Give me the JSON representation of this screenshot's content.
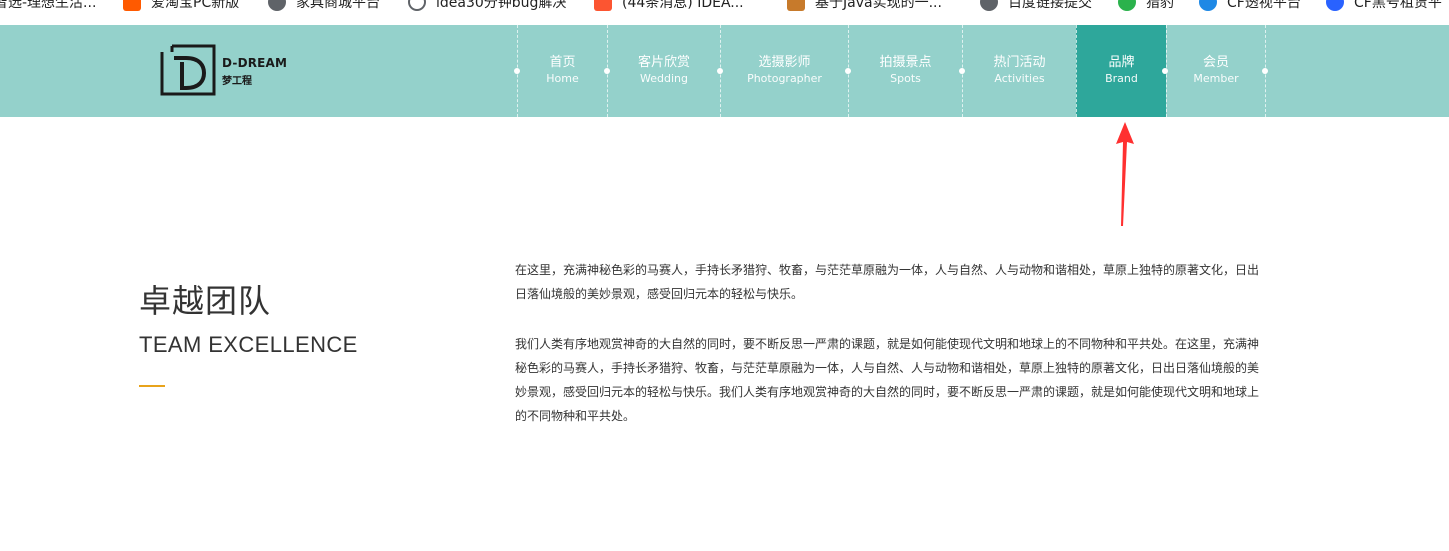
{
  "bookmarks": [
    {
      "label": "智选-理想生活...",
      "icon": "bookmark-icon",
      "color": "#b0b0b0"
    },
    {
      "label": "爱淘宝PC新版",
      "icon": "taobao-icon",
      "color": "#ff5a00"
    },
    {
      "label": "家具商城平台",
      "icon": "globe-icon",
      "color": "#5f6368"
    },
    {
      "label": "idea30分钟bug解决",
      "icon": "search-icon",
      "color": "#5f6368"
    },
    {
      "label": "(44条消息) IDEA...",
      "icon": "csdn-icon",
      "color": "#fc5531"
    },
    {
      "label": "基于Java实现的一...",
      "icon": "bookmark-icon",
      "color": "#c77a2b"
    },
    {
      "label": "百度链接提交",
      "icon": "globe-icon",
      "color": "#5f6368"
    },
    {
      "label": "猎豹",
      "icon": "leaf-icon",
      "color": "#2bb24c"
    },
    {
      "label": "CF透视平台",
      "icon": "cf-icon",
      "color": "#1e88e5"
    },
    {
      "label": "CF黑号租赁平",
      "icon": "paw-icon",
      "color": "#2962ff"
    }
  ],
  "header": {
    "logo": {
      "en": "D-DREAM",
      "cn": "梦工程"
    },
    "nav": [
      {
        "cn": "首页",
        "en": "Home",
        "active": false
      },
      {
        "cn": "客片欣赏",
        "en": "Wedding",
        "active": false
      },
      {
        "cn": "选摄影师",
        "en": "Photographer",
        "active": false
      },
      {
        "cn": "拍摄景点",
        "en": "Spots",
        "active": false
      },
      {
        "cn": "热门活动",
        "en": "Activities",
        "active": false
      },
      {
        "cn": "品牌",
        "en": "Brand",
        "active": true
      },
      {
        "cn": "会员",
        "en": "Member",
        "active": false
      }
    ]
  },
  "colors": {
    "header_bg": "#94d1cb",
    "active_bg": "#2ea79b",
    "accent_line": "#e8a31b",
    "annotation_arrow": "#ff3030"
  },
  "content": {
    "title_cn": "卓越团队",
    "title_en": "TEAM EXCELLENCE",
    "paragraph1": "在这里，充满神秘色彩的马赛人，手持长矛猎狩、牧畜，与茫茫草原融为一体，人与自然、人与动物和谐相处，草原上独特的原著文化，日出日落仙境般的美妙景观，感受回归元本的轻松与快乐。",
    "paragraph2": "我们人类有序地观赏神奇的大自然的同时，要不断反思一严肃的课题，就是如何能使现代文明和地球上的不同物种和平共处。在这里，充满神秘色彩的马赛人，手持长矛猎狩、牧畜，与茫茫草原融为一体，人与自然、人与动物和谐相处，草原上独特的原著文化，日出日落仙境般的美妙景观，感受回归元本的轻松与快乐。我们人类有序地观赏神奇的大自然的同时，要不断反思一严肃的课题，就是如何能使现代文明和地球上的不同物种和平共处。"
  }
}
